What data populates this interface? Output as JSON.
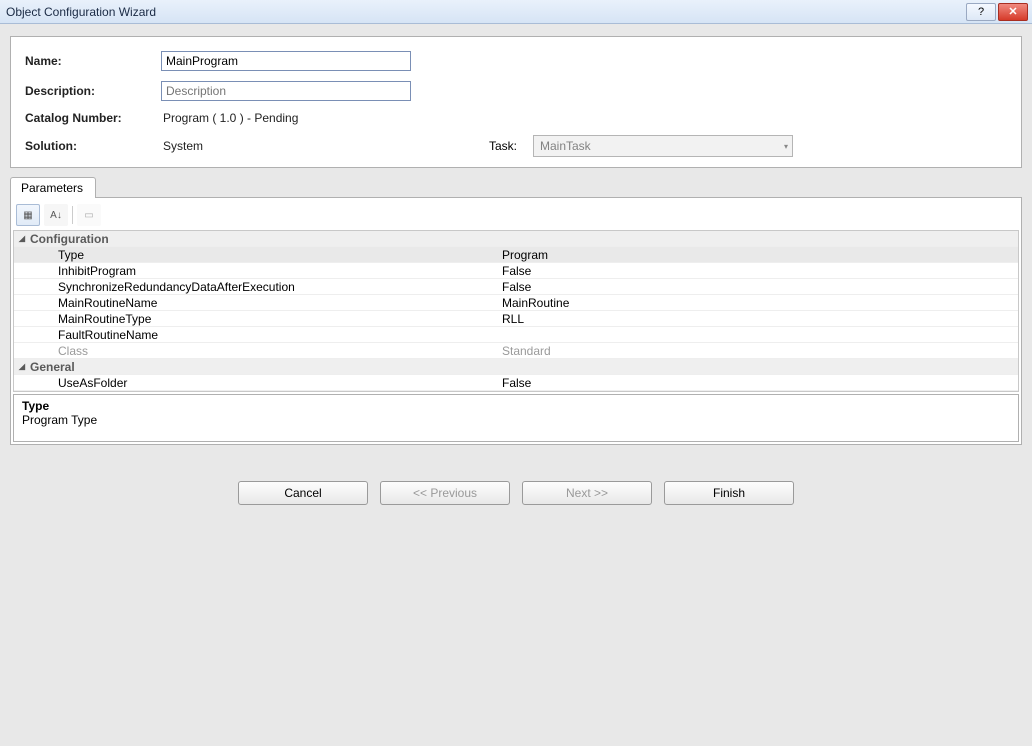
{
  "window": {
    "title": "Object Configuration Wizard"
  },
  "form": {
    "name_label": "Name:",
    "name_value": "MainProgram",
    "desc_label": "Description:",
    "desc_placeholder": "Description",
    "desc_value": "",
    "catalog_label": "Catalog Number:",
    "catalog_value": "Program    ( 1.0 )  -  Pending",
    "solution_label": "Solution:",
    "solution_value": "System",
    "task_label": "Task:",
    "task_value": "MainTask"
  },
  "tabs": {
    "parameters": "Parameters"
  },
  "grid": {
    "groups": [
      {
        "name": "Configuration",
        "rows": [
          {
            "key": "Type",
            "value": "Program",
            "selected": true
          },
          {
            "key": "InhibitProgram",
            "value": "False"
          },
          {
            "key": "SynchronizeRedundancyDataAfterExecution",
            "value": "False"
          },
          {
            "key": "MainRoutineName",
            "value": "MainRoutine"
          },
          {
            "key": "MainRoutineType",
            "value": "RLL"
          },
          {
            "key": "FaultRoutineName",
            "value": ""
          },
          {
            "key": "Class",
            "value": "Standard",
            "disabled": true
          }
        ]
      },
      {
        "name": "General",
        "rows": [
          {
            "key": "UseAsFolder",
            "value": "False"
          }
        ]
      }
    ]
  },
  "help": {
    "title": "Type",
    "text": "Program Type"
  },
  "buttons": {
    "cancel": "Cancel",
    "previous": "<<  Previous",
    "next": "Next  >>",
    "finish": "Finish"
  },
  "icons": {
    "help": "?",
    "close": "✕",
    "sort": "A↓",
    "cat": "▦",
    "page": "▭",
    "chev": "▾",
    "tri": "▸",
    "tri_open": "◢"
  }
}
